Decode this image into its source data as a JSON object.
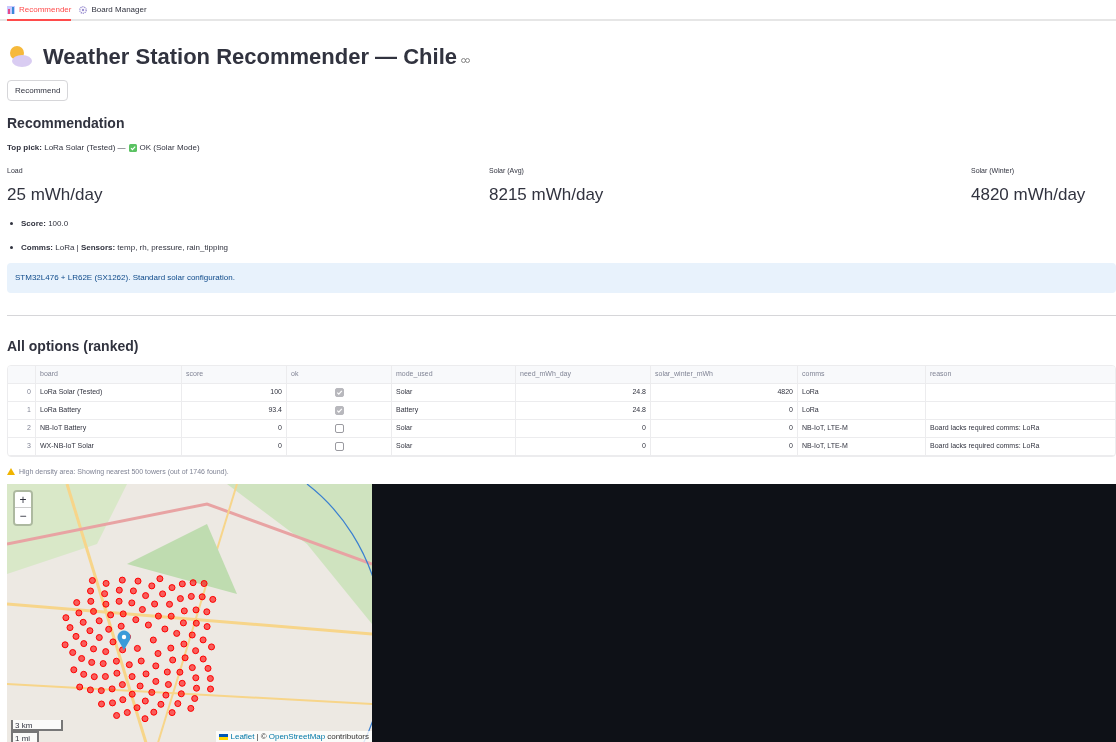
{
  "tabs": [
    {
      "label": "Recommender",
      "selected": true
    },
    {
      "label": "Board Manager",
      "selected": false
    }
  ],
  "title": "Weather Station Recommender — Chile",
  "recommend_button": "Recommend",
  "recommendation": {
    "heading": "Recommendation",
    "top_pick": "**Top pick:** LoRa Solar (Tested) —",
    "status": "OK (Solar Mode)",
    "metrics": [
      {
        "label": "Load",
        "value": "25 mWh/day"
      },
      {
        "label": "Solar (Avg)",
        "value": "8215 mWh/day"
      },
      {
        "label": "Solar (Winter)",
        "value": "4820 mWh/day"
      }
    ],
    "bullets": [
      "**Score:** 100.0",
      "**Comms:** LoRa | **Sensors:** temp, rh, pressure, rain_tipping"
    ],
    "info": "STM32L476 + LR62E (SX1262). Standard solar configuration."
  },
  "all_options": {
    "heading": "All options (ranked)",
    "table": {
      "columns": [
        "board",
        "score",
        "ok",
        "mode_used",
        "need_mWh_day",
        "solar_winter_mWh",
        "comms",
        "reason"
      ],
      "rows": [
        {
          "index": "0",
          "board": "LoRa Solar (Tested)",
          "score": "100",
          "ok": true,
          "mode_used": "Solar",
          "need_mWh_day": "24.8",
          "solar_winter_mWh": "4820",
          "comms": "LoRa",
          "reason": ""
        },
        {
          "index": "1",
          "board": "LoRa Battery",
          "score": "93.4",
          "ok": true,
          "mode_used": "Battery",
          "need_mWh_day": "24.8",
          "solar_winter_mWh": "0",
          "comms": "LoRa",
          "reason": ""
        },
        {
          "index": "2",
          "board": "NB-IoT Battery",
          "score": "0",
          "ok": false,
          "mode_used": "Solar",
          "need_mWh_day": "0",
          "solar_winter_mWh": "0",
          "comms": "NB-IoT, LTE-M",
          "reason": "Board lacks required comms: LoRa"
        },
        {
          "index": "3",
          "board": "WX-NB-IoT Solar",
          "score": "0",
          "ok": false,
          "mode_used": "Solar",
          "need_mWh_day": "0",
          "solar_winter_mWh": "0",
          "comms": "NB-IoT, LTE-M",
          "reason": "Board lacks required comms: LoRa"
        }
      ]
    }
  },
  "warning": "High density area: Showing nearest 500 towers (out of 1746 found).",
  "map": {
    "kind": "picture",
    "zoom_in": "+",
    "zoom_out": "−",
    "scale_metric": "3 km",
    "scale_imperial": "1 mi",
    "attribution_link": "Leaflet",
    "attribution_sep": "| ©",
    "attribution_osm": "OpenStreetMap",
    "attribution_rest": "contributors"
  }
}
